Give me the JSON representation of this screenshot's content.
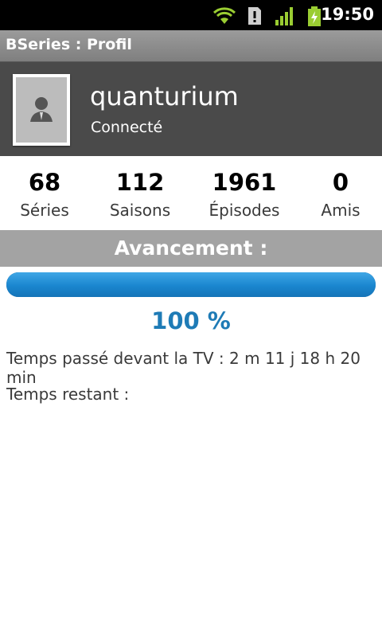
{
  "statusbar": {
    "time": "19:50",
    "icons": [
      "wifi-icon",
      "sd-card-alert-icon",
      "signal-icon",
      "battery-charging-icon"
    ]
  },
  "titlebar": {
    "title": "BSeries : Profil"
  },
  "profile": {
    "username": "quanturium",
    "status": "Connecté"
  },
  "stats": [
    {
      "value": "68",
      "label": "Séries"
    },
    {
      "value": "112",
      "label": "Saisons"
    },
    {
      "value": "1961",
      "label": "Épisodes"
    },
    {
      "value": "0",
      "label": "Amis"
    }
  ],
  "progress": {
    "header": "Avancement :",
    "fraction": 1.0,
    "percent_text": "100 %",
    "tv_time": "Temps passé devant la TV : 2 m 11 j 18 h 20 min",
    "remaining": "Temps restant :"
  },
  "colors": {
    "accent": "#1e7bb6",
    "header_bg": "#4a4a4a"
  }
}
